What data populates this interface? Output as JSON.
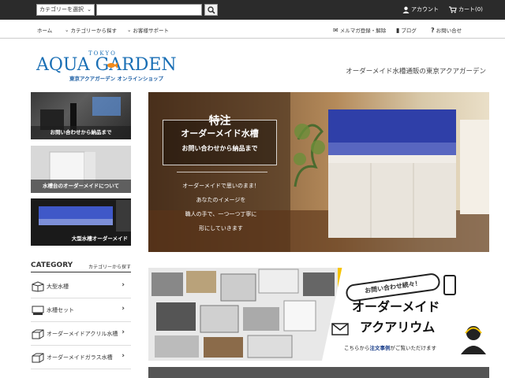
{
  "topbar": {
    "category_select": "カテゴリーを選択",
    "search_placeholder": "",
    "account": "アカウント",
    "cart": "カート(0)"
  },
  "nav": {
    "home": "ホーム",
    "browse_category": "カテゴリーから探す",
    "support": "お客様サポート",
    "newsletter": "メルマガ登録・解除",
    "blog": "ブログ",
    "contact": "お問い合せ"
  },
  "logo": {
    "tokyo": "TOKYO",
    "main": "AQUA GARDEN",
    "sub": "東京アクアガーデン オンラインショップ"
  },
  "tagline": "オーダーメイド水槽通販の東京アクアガーデン",
  "left_banners": [
    {
      "caption": "お問い合わせから納品まで"
    },
    {
      "caption": "水槽台のオーダーメイドについて"
    },
    {
      "caption": "大型水槽オーダーメイド"
    }
  ],
  "category": {
    "title": "CATEGORY",
    "more": "カテゴリーから探す",
    "items": [
      {
        "label": "大型水槽"
      },
      {
        "label": "水槽セット"
      },
      {
        "label": "オーダーメイドアクリル水槽"
      },
      {
        "label": "オーダーメイドガラス水槽"
      }
    ]
  },
  "hero": {
    "line1": "特注",
    "line2": "オーダーメイド水槽",
    "line3": "お問い合わせから納品まで",
    "body1": "オーダーメイドで思いのまま！",
    "body2": "あなたのイメージを",
    "body3": "職人の手で、一つ一つ丁寧に",
    "body4": "形にしていきます"
  },
  "promo": {
    "bubble": "お問い合わせ続々！",
    "title1": "オーダーメイド",
    "title2": "アクアリウム",
    "foot_pre": "こちらから",
    "foot_bold": "注文事例",
    "foot_post": "がご覧いただけます"
  }
}
